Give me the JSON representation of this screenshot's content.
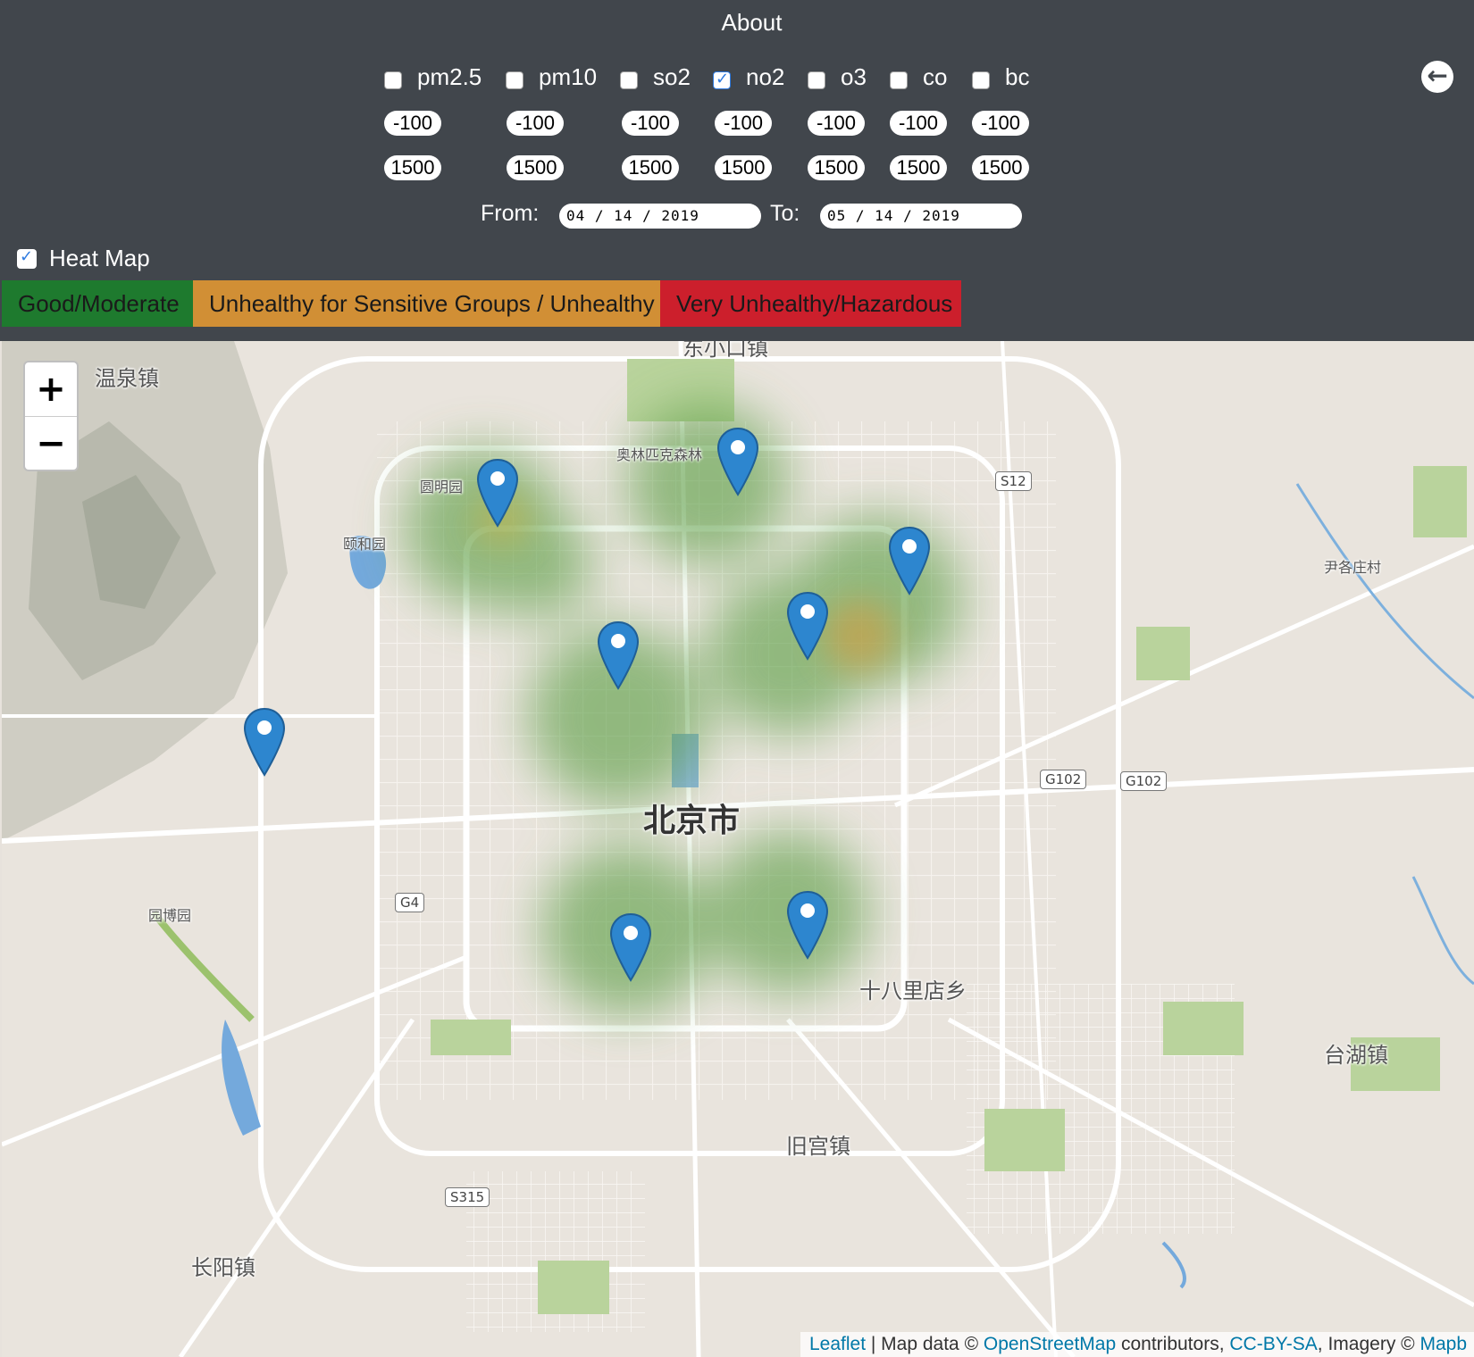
{
  "header": {
    "about_label": "About",
    "back_icon": "arrow-left-circle-icon"
  },
  "pollutants": [
    {
      "label": "pm2.5",
      "checked": false,
      "min": "-100",
      "max": "1500"
    },
    {
      "label": "pm10",
      "checked": false,
      "min": "-100",
      "max": "1500"
    },
    {
      "label": "so2",
      "checked": false,
      "min": "-100",
      "max": "1500"
    },
    {
      "label": "no2",
      "checked": true,
      "min": "-100",
      "max": "1500"
    },
    {
      "label": "o3",
      "checked": false,
      "min": "-100",
      "max": "1500"
    },
    {
      "label": "co",
      "checked": false,
      "min": "-100",
      "max": "1500"
    },
    {
      "label": "bc",
      "checked": false,
      "min": "-100",
      "max": "1500"
    }
  ],
  "date_range": {
    "from_label": "From:",
    "from_value": "04 / 14 / 2019",
    "to_label": "To:",
    "to_value": "05 / 14 / 2019"
  },
  "heatmap": {
    "label": "Heat Map",
    "checked": true
  },
  "legend": [
    {
      "label": "Good/Moderate",
      "color": "#1e7a2e"
    },
    {
      "label": "Unhealthy for Sensitive Groups / Unhealthy",
      "color": "#d18f35"
    },
    {
      "label": "Very Unhealthy/Hazardous",
      "color": "#cc1f2c"
    }
  ],
  "map": {
    "zoom_in": "+",
    "zoom_out": "−",
    "places": {
      "wenquan": "温泉镇",
      "dongxiaokou": "东小口镇",
      "olympic": "奥林匹克森林",
      "yuanmingyuan": "圆明园",
      "yiheyuan": "颐和园",
      "beijing": "北京市",
      "yinge": "尹各庄村",
      "yuanboyuan": "园博园",
      "shibalidian": "十八里店乡",
      "taihu": "台湖镇",
      "jiugong": "旧宫镇",
      "changyang": "长阳镇"
    },
    "shields": {
      "s12": "S12",
      "g102a": "G102",
      "g102b": "G102",
      "g4": "G4",
      "s315": "S315"
    },
    "markers": [
      "marker-1",
      "marker-2",
      "marker-3",
      "marker-4",
      "marker-5",
      "marker-6",
      "marker-7",
      "marker-8"
    ],
    "attribution": {
      "leaflet": "Leaflet",
      "sep": " | Map data © ",
      "osm": "OpenStreetMap",
      "contrib": " contributors, ",
      "license": "CC-BY-SA",
      "imagery": ", Imagery © ",
      "mapbox": "Mapb"
    }
  }
}
